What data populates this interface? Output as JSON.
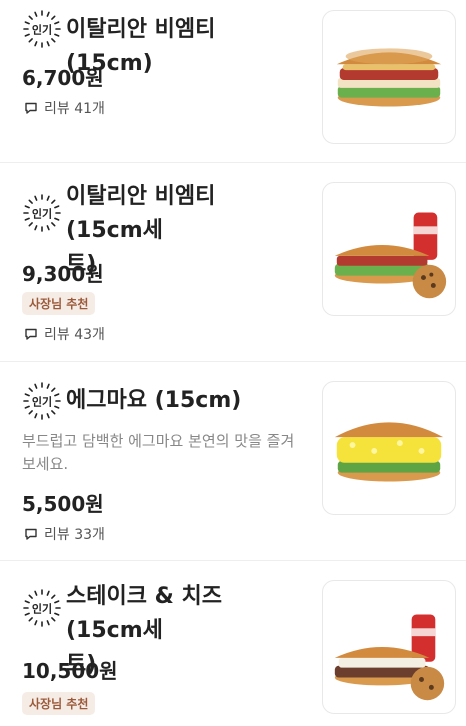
{
  "menu": {
    "items": [
      {
        "popular_label": "인기",
        "title": "이탈리안 비엠티 (15cm)",
        "price": "6,700원",
        "review": "리뷰 41개",
        "image_icon": "sandwich-image"
      },
      {
        "popular_label": "인기",
        "title_line1": "이탈리안 비엠티 (15cm세",
        "title_line2": "트)",
        "price": "9,300원",
        "owner_tag": "사장님 추천",
        "review": "리뷰 43개",
        "image_icon": "sandwich-set-image"
      },
      {
        "popular_label": "인기",
        "title": "에그마요 (15cm)",
        "desc_line1": "부드럽고 담백한 에그마요 본연의 맛을 즐겨",
        "desc_line2": "보세요.",
        "price": "5,500원",
        "review": "리뷰 33개",
        "image_icon": "egg-mayo-sandwich-image"
      },
      {
        "popular_label": "인기",
        "title_line1": "스테이크 & 치즈 (15cm세",
        "title_line2": "트)",
        "price": "10,500원",
        "owner_tag": "사장님 추천",
        "image_icon": "steak-cheese-set-image"
      }
    ]
  },
  "colors": {
    "owner_tag_bg": "#f6ece6",
    "owner_tag_text": "#9b5a3a",
    "text_primary": "#222222",
    "text_secondary": "#888888"
  }
}
